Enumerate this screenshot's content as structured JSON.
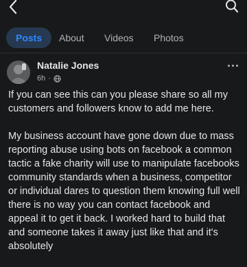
{
  "header": {
    "back_icon": "chevron-left-icon",
    "search_icon": "search-icon"
  },
  "tabs": [
    {
      "label": "Posts",
      "active": true
    },
    {
      "label": "About",
      "active": false
    },
    {
      "label": "Videos",
      "active": false
    },
    {
      "label": "Photos",
      "active": false
    }
  ],
  "post": {
    "author": "Natalie Jones",
    "time": "6h",
    "privacy_icon": "globe-icon",
    "more_icon": "more-icon",
    "paragraphs": [
      "If you can see this can you please share so all my customers and followers know to add me here.",
      "My business account have gone down due to mass reporting abuse using bots on facebook a common tactic a fake charity will use to manipulate facebooks community standards when a business, competitor or individual dares to question them knowing full well there is no way you can contact facebook and appeal it to get it back. I worked hard to build that and someone takes it away just like that and it's absolutely"
    ]
  },
  "colors": {
    "background": "#18191a",
    "accent": "#2d88ff",
    "active_tab_bg": "#263951",
    "text": "#e4e6eb",
    "muted": "#b0b3b8"
  }
}
